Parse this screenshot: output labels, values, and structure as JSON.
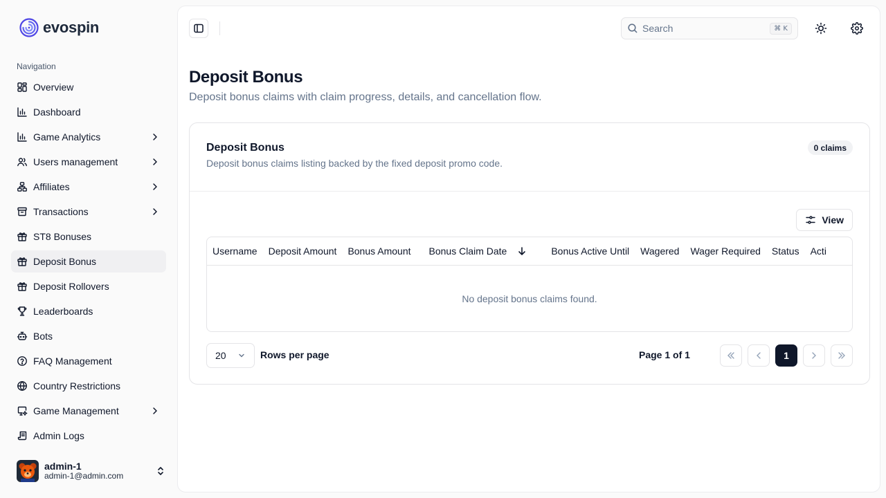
{
  "brand": {
    "name": "evospin"
  },
  "nav": {
    "heading": "Navigation",
    "items": [
      {
        "label": "Overview",
        "icon": "grid-icon",
        "chevron": false
      },
      {
        "label": "Dashboard",
        "icon": "bar-chart-icon",
        "chevron": false
      },
      {
        "label": "Game Analytics",
        "icon": "bar-chart-icon",
        "chevron": true
      },
      {
        "label": "Users management",
        "icon": "users-icon",
        "chevron": true
      },
      {
        "label": "Affiliates",
        "icon": "network-icon",
        "chevron": true
      },
      {
        "label": "Transactions",
        "icon": "archive-icon",
        "chevron": true
      },
      {
        "label": "ST8 Bonuses",
        "icon": "gift-icon",
        "chevron": false
      },
      {
        "label": "Deposit Bonus",
        "icon": "gift-icon",
        "chevron": false,
        "active": true
      },
      {
        "label": "Deposit Rollovers",
        "icon": "gift-icon",
        "chevron": false
      },
      {
        "label": "Leaderboards",
        "icon": "trophy-icon",
        "chevron": false
      },
      {
        "label": "Bots",
        "icon": "bot-icon",
        "chevron": false
      },
      {
        "label": "FAQ Management",
        "icon": "help-circle-icon",
        "chevron": false
      },
      {
        "label": "Country Restrictions",
        "icon": "globe-icon",
        "chevron": false
      },
      {
        "label": "Game Management",
        "icon": "monitor-icon",
        "chevron": true
      },
      {
        "label": "Admin Logs",
        "icon": "scroll-icon",
        "chevron": false
      }
    ]
  },
  "user": {
    "name": "admin-1",
    "email": "admin-1@admin.com"
  },
  "topbar": {
    "search_placeholder": "Search",
    "shortcut": "⌘ K"
  },
  "page": {
    "title": "Deposit Bonus",
    "subtitle": "Deposit bonus claims with claim progress, details, and cancellation flow."
  },
  "card": {
    "title": "Deposit Bonus",
    "description": "Deposit bonus claims listing backed by the fixed deposit promo code.",
    "badge": "0 claims",
    "view_label": "View"
  },
  "table": {
    "columns": [
      "Username",
      "Deposit Amount",
      "Bonus Amount",
      "Bonus Claim Date",
      "Bonus Active Until",
      "Wagered",
      "Wager Required",
      "Status",
      "Acti"
    ],
    "empty_text": "No deposit bonus claims found."
  },
  "pagination": {
    "rows_per_page_value": "20",
    "rows_per_page_label": "Rows per page",
    "page_info": "Page 1 of 1",
    "current_page": "1"
  }
}
